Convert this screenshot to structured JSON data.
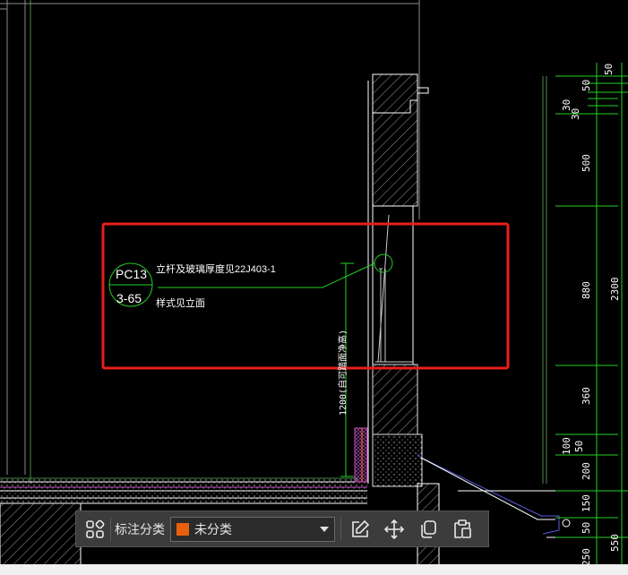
{
  "drawing": {
    "window_label": {
      "code": "PC13",
      "sheet": "3-65"
    },
    "note_line1": "立杆及玻璃厚度见22J403-1",
    "note_line2": "样式见立面",
    "rail_height": "1200(自可踏面净高)",
    "dims_outer": [
      "50",
      "2300",
      "550"
    ],
    "dims_inner": [
      "50",
      "50",
      "30",
      "30",
      "500",
      "880",
      "360",
      "50",
      "100",
      "200",
      "150",
      "50",
      "250"
    ]
  },
  "toolbar": {
    "label": "标注分类",
    "category_value": "未分类",
    "category_color": "#e8600e"
  },
  "icons": [
    "category-grid-icon",
    "edit-icon",
    "move-icon",
    "copy-icon",
    "paste-icon"
  ],
  "colors": {
    "highlight": "#e81e1e",
    "cad_green": "#22d022",
    "cad_white": "#ffffff",
    "cad_magenta": "#d040d0",
    "cad_blue": "#5a5ad8"
  }
}
